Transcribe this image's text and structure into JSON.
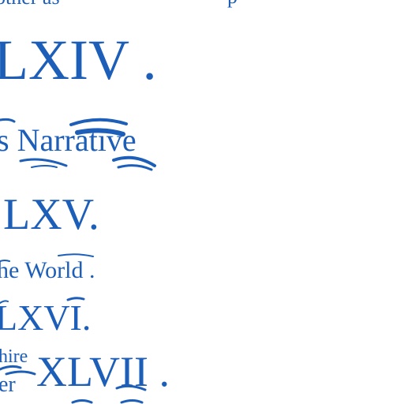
{
  "document": {
    "lines": [
      {
        "id": "top-fragment",
        "text": "other as"
      },
      {
        "id": "top-fragment-right",
        "text": "p"
      },
      {
        "id": "numeral-lxiv",
        "text": "LXIV ."
      },
      {
        "id": "heading-narrative",
        "text": "s Narrative"
      },
      {
        "id": "numeral-lxv",
        "text": "LXV."
      },
      {
        "id": "heading-world",
        "text": "he World ."
      },
      {
        "id": "numeral-lxvi",
        "text": "LXVI."
      },
      {
        "id": "fragment-mire",
        "text": "hire"
      },
      {
        "id": "fragment-er",
        "text": "er"
      },
      {
        "id": "numeral-xlvii",
        "text": "XLVII ."
      }
    ]
  },
  "colors": {
    "ink": "#1d5fb8",
    "background": "#ffffff"
  }
}
